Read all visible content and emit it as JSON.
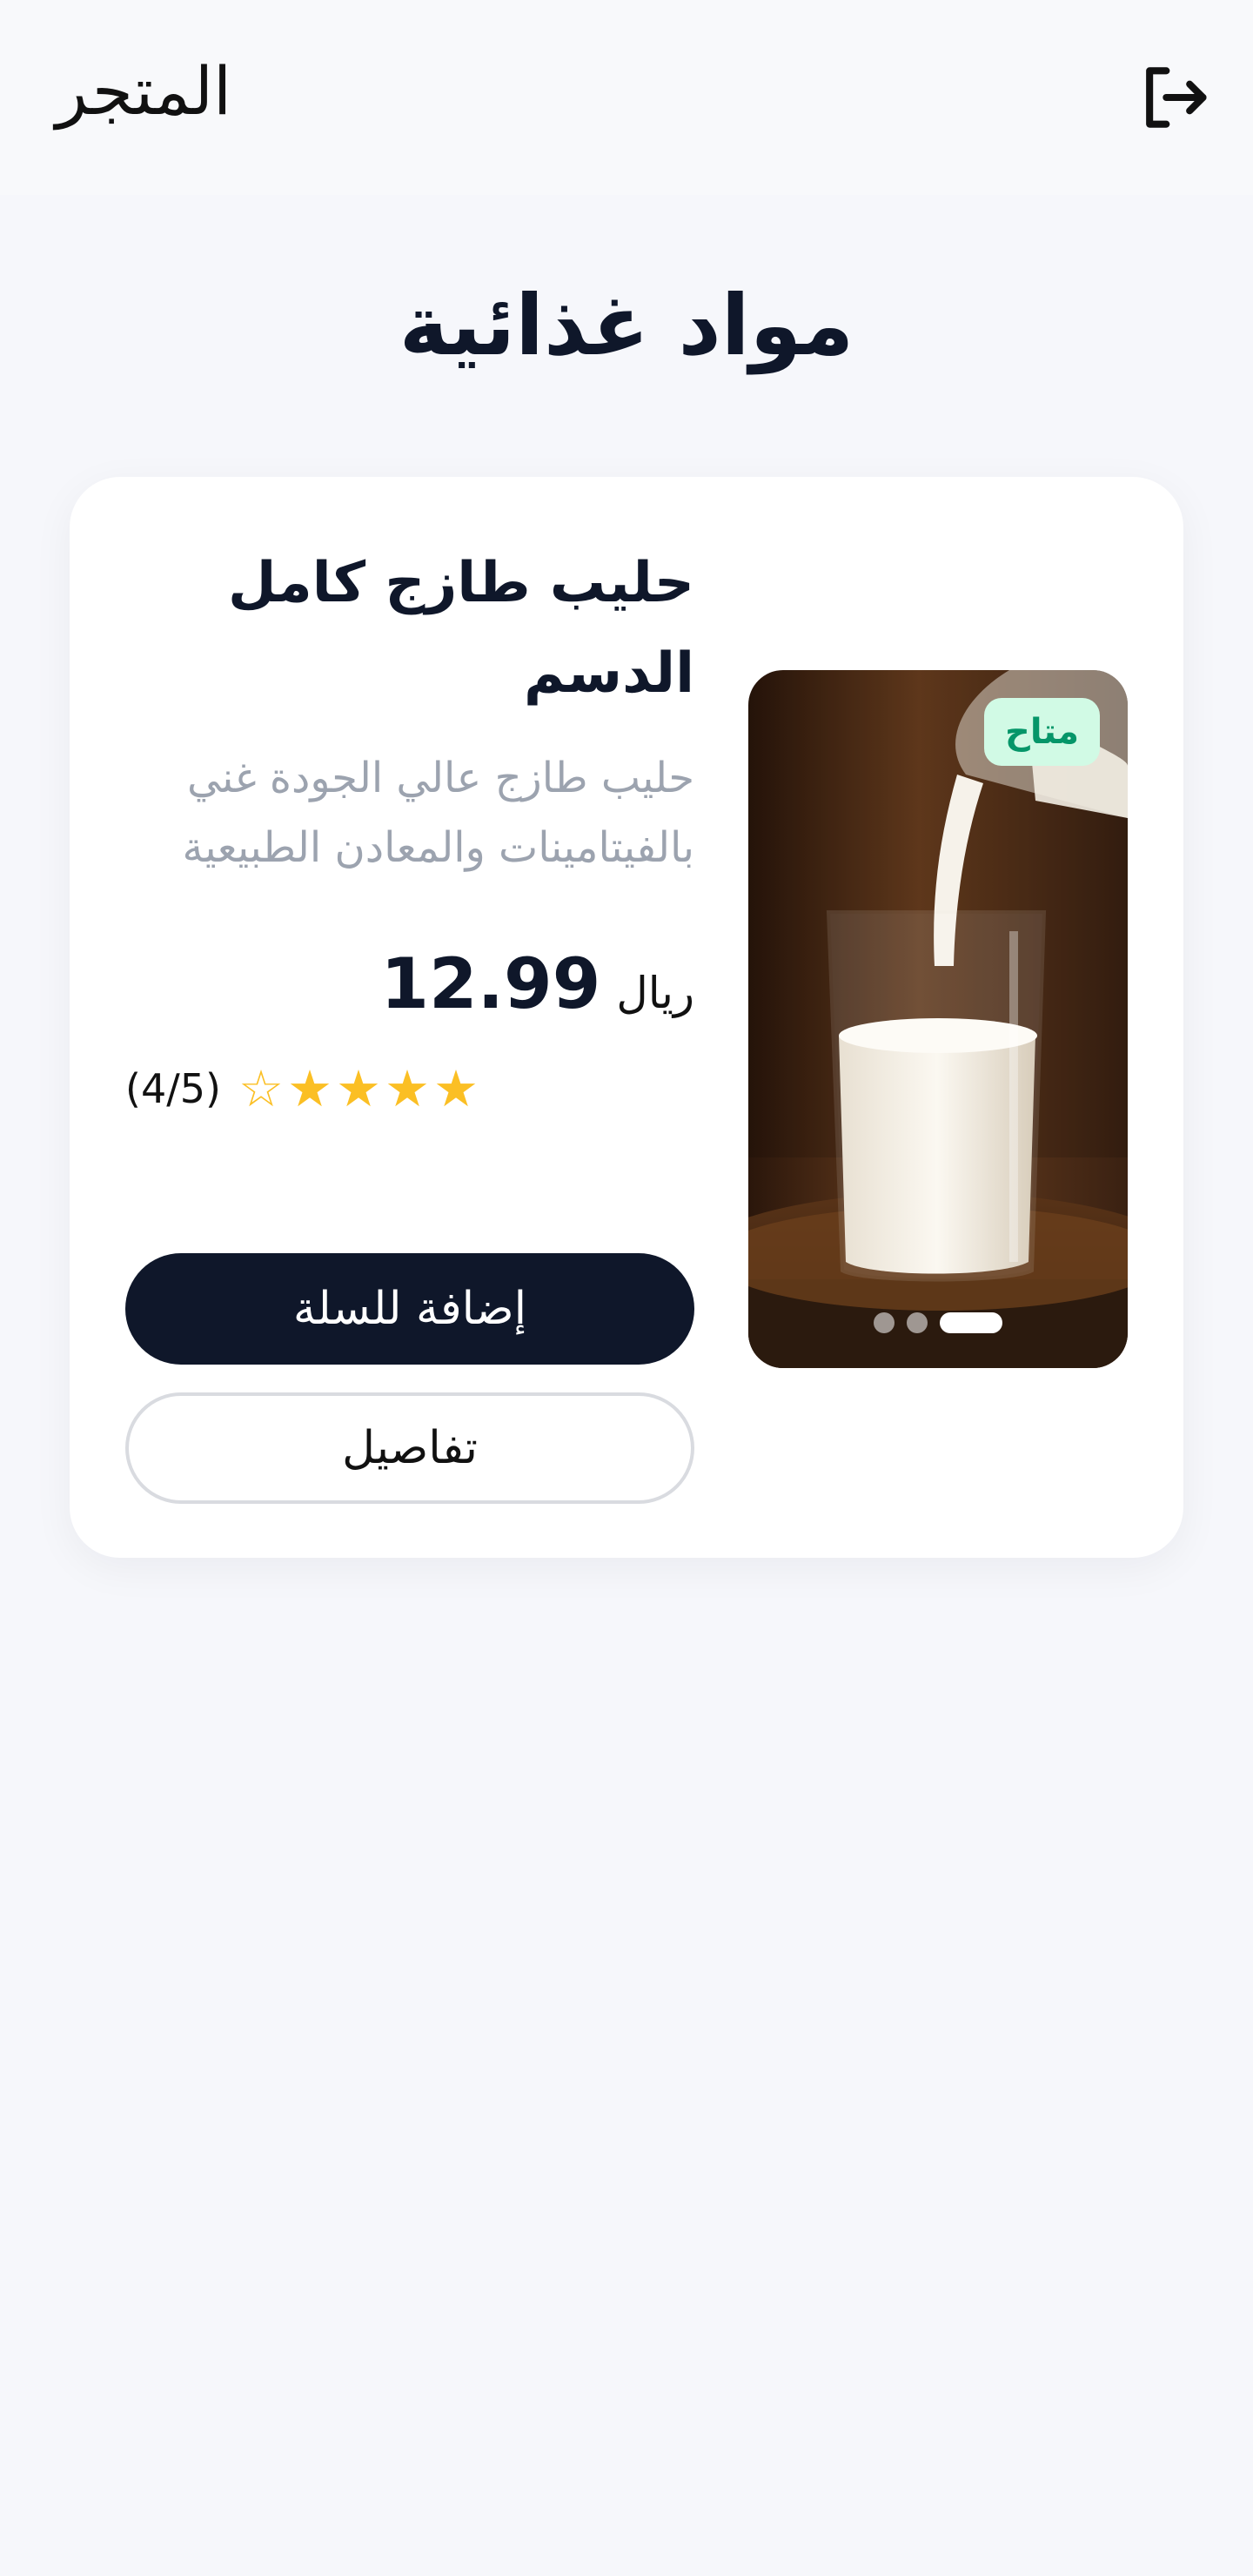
{
  "header": {
    "title": "المتجر",
    "logout_icon": "logout-icon"
  },
  "page": {
    "heading": "مواد غذائية"
  },
  "product": {
    "name": "حليب طازج كامل الدسم",
    "description": "حليب طازج عالي الجودة غني بالفيتامينات والمعادن الطبيعية",
    "price": "12.99",
    "currency": "ريال",
    "rating": 4,
    "rating_max": 5,
    "rating_text": "(4/5)",
    "badge": "متاح",
    "image_count": 3,
    "active_image_index": 0,
    "add_to_cart_label": "إضافة للسلة",
    "details_label": "تفاصيل"
  },
  "colors": {
    "background": "#f6f7fb",
    "primary": "#0f172a",
    "star": "#fbbf24",
    "badge_bg": "#d1fae5",
    "badge_text": "#059669",
    "muted_text": "#9ca3af"
  }
}
